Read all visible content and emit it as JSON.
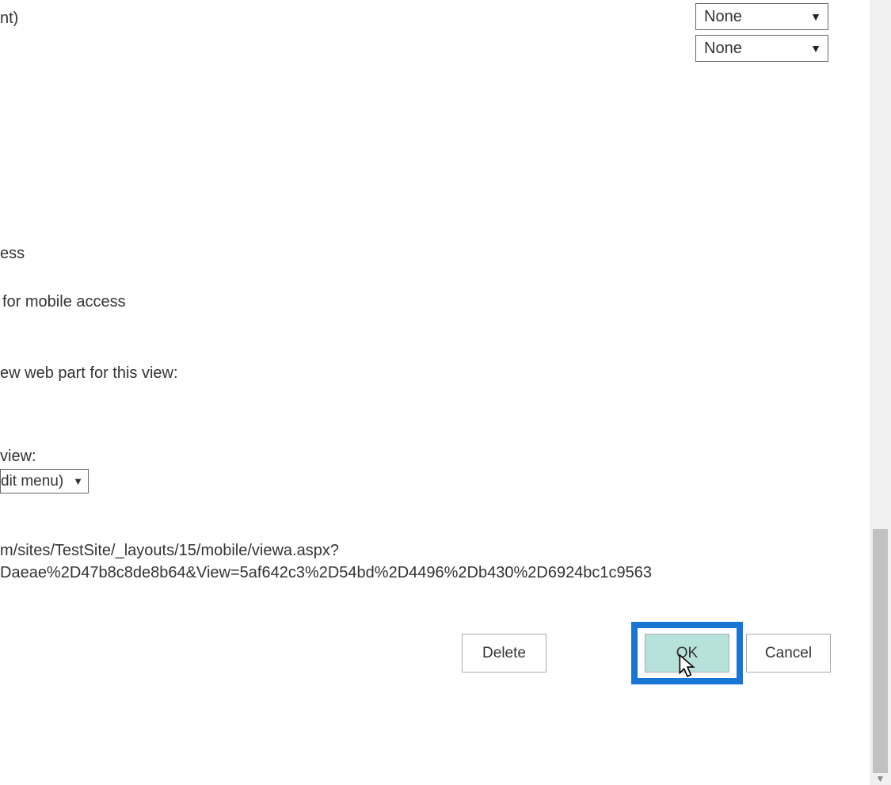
{
  "selects": {
    "sort1": "None",
    "sort2": "None",
    "view_menu": "dit menu)"
  },
  "fragments": {
    "nt": "nt)",
    "ess": "ess",
    "mobile_access": "for mobile access",
    "web_part": "ew web part for this view:",
    "this_view": "view:"
  },
  "url": {
    "line1": "m/sites/TestSite/_layouts/15/mobile/viewa.aspx?",
    "line2": "Daeae%2D47b8c8de8b64&View=5af642c3%2D54bd%2D4496%2Db430%2D6924bc1c9563"
  },
  "buttons": {
    "delete": "Delete",
    "ok": "OK",
    "cancel": "Cancel"
  }
}
